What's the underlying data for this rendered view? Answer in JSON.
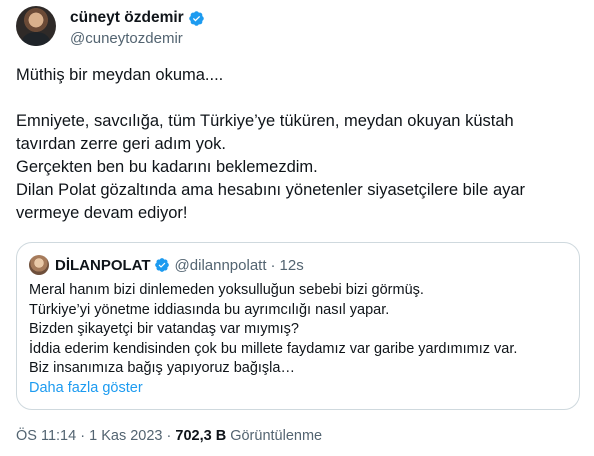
{
  "author": {
    "display_name": "cüneyt özdemir",
    "handle": "@cuneytozdemir"
  },
  "tweet": {
    "lines": [
      "Müthiş bir meydan okuma....",
      "",
      "Emniyete, savcılığa, tüm Türkiye’ye tüküren, meydan okuyan küstah",
      "tavırdan zerre geri adım yok.",
      "Gerçekten ben bu kadarını beklemezdim.",
      "Dilan Polat gözaltında ama hesabını yönetenler siyasetçilere bile ayar",
      "vermeye devam ediyor!"
    ]
  },
  "quote": {
    "display_name": "DİLANPOLAT",
    "handle": "@dilannpolatt",
    "separator": "·",
    "time": "12s",
    "lines": [
      "Meral hanım bizi dinlemeden yoksulluğun sebebi bizi görmüş.",
      "Türkiye’yi yönetme iddiasında bu ayrımcılığı nasıl yapar.",
      "Bizden  şikayetçi bir vatandaş var mıymış?",
      "İddia ederim kendisinden çok bu millete faydamız var garibe yardımımız var.",
      "Biz insanımıza bağış yapıyoruz bağışla…"
    ],
    "show_more": "Daha fazla göster"
  },
  "meta": {
    "time": "ÖS 11:14",
    "separator": "·",
    "date": "1 Kas 2023",
    "separator2": "·",
    "views": "702,3 B",
    "views_label": "Görüntülenme"
  },
  "colors": {
    "verified": "#1d9bf0",
    "link": "#1d9bf0",
    "secondary_text": "#536471",
    "border": "#cfd9de"
  },
  "icons": {
    "verified": "verified-badge-icon"
  }
}
